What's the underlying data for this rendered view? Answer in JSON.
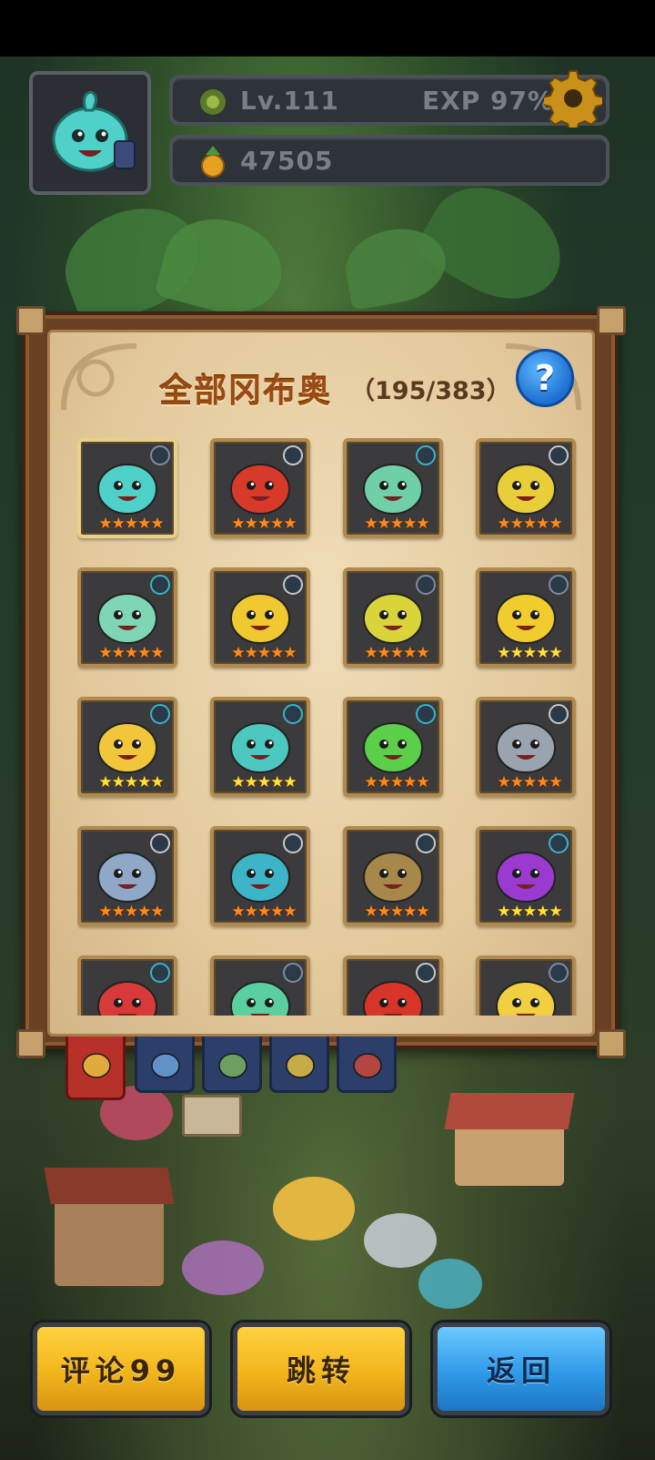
{
  "header": {
    "level_text": "Lv.111",
    "exp_text": "EXP 97%",
    "coins": "47505"
  },
  "panel": {
    "title": "全部冈布奥",
    "count": "（195/383）",
    "help_symbol": "?"
  },
  "cards": [
    {
      "name": "slime-1",
      "body": "#4fd0c8",
      "badge": "#7f8aa0",
      "stars": "orange",
      "sel": true
    },
    {
      "name": "slime-2",
      "body": "#d83a2a",
      "badge": "#c8c8c8",
      "stars": "orange"
    },
    {
      "name": "slime-3",
      "body": "#6fd0a8",
      "badge": "#35b5c5",
      "stars": "orange"
    },
    {
      "name": "slime-4",
      "body": "#e8cf3a",
      "badge": "#c8c8c8",
      "stars": "orange"
    },
    {
      "name": "slime-5",
      "body": "#7fd6b4",
      "badge": "#35b5c5",
      "stars": "orange"
    },
    {
      "name": "slime-6",
      "body": "#f0c830",
      "badge": "#c8c8c8",
      "stars": "orange"
    },
    {
      "name": "slime-7",
      "body": "#d9d43a",
      "badge": "#7f8aa0",
      "stars": "orange"
    },
    {
      "name": "slime-8",
      "body": "#f0cc2e",
      "badge": "#7f8aa0",
      "stars": "yellow"
    },
    {
      "name": "slime-9",
      "body": "#f2c63a",
      "badge": "#35b5c5",
      "stars": "yellow"
    },
    {
      "name": "slime-10",
      "body": "#4cc8c0",
      "badge": "#35b5c5",
      "stars": "yellow"
    },
    {
      "name": "slime-11",
      "body": "#5ccf4a",
      "badge": "#35b5c5",
      "stars": "orange"
    },
    {
      "name": "slime-12",
      "body": "#9aa4ae",
      "badge": "#c8c8c8",
      "stars": "orange"
    },
    {
      "name": "slime-13",
      "body": "#8fa8c8",
      "badge": "#c8c8c8",
      "stars": "orange"
    },
    {
      "name": "slime-14",
      "body": "#3eb4c8",
      "badge": "#c8c8c8",
      "stars": "orange"
    },
    {
      "name": "slime-15",
      "body": "#a8884a",
      "badge": "#c8c8c8",
      "stars": "orange"
    },
    {
      "name": "slime-16",
      "body": "#9a3ad0",
      "badge": "#35b5c5",
      "stars": "yellow"
    },
    {
      "name": "slime-17",
      "body": "#d83a3a",
      "badge": "#35b5c5",
      "stars": "orange"
    },
    {
      "name": "slime-18",
      "body": "#5acfa0",
      "badge": "#7f8aa0",
      "stars": "orange"
    },
    {
      "name": "slime-19",
      "body": "#d8342a",
      "badge": "#c8c8c8",
      "stars": "orange"
    },
    {
      "name": "slime-20",
      "body": "#f0d040",
      "badge": "#7f8aa0",
      "stars": "orange"
    }
  ],
  "tabs": [
    {
      "name": "tab-all",
      "color": "#b7312a"
    },
    {
      "name": "tab-blue",
      "color": "#2b3f6a"
    },
    {
      "name": "tab-green",
      "color": "#2b3f6a"
    },
    {
      "name": "tab-yellow",
      "color": "#2b3f6a"
    },
    {
      "name": "tab-red",
      "color": "#2b3f6a"
    }
  ],
  "buttons": {
    "comment_label": "评论99",
    "jump_label": "跳转",
    "back_label": "返回"
  }
}
